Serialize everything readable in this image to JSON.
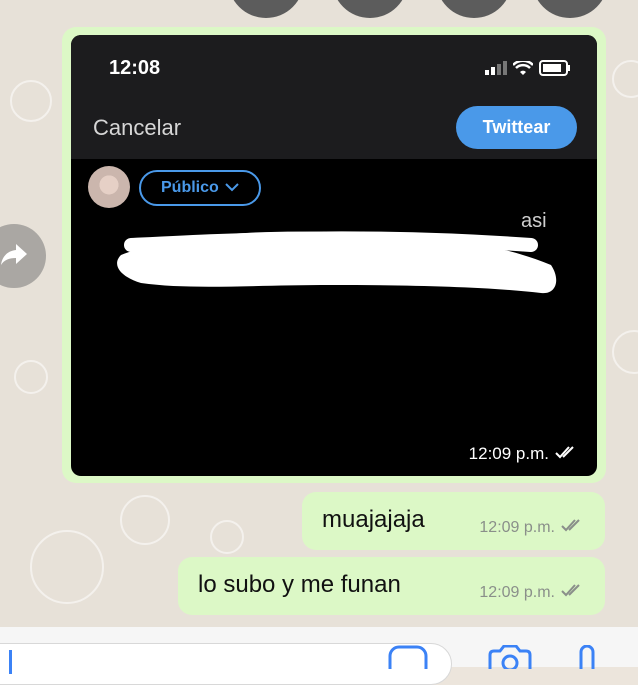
{
  "screenshot": {
    "clock": "12:08",
    "cancel_label": "Cancelar",
    "tweet_button_label": "Twittear",
    "audience_label": "Público",
    "tweet_text_visible": "asi",
    "timestamp": "12:09 p.m."
  },
  "messages": [
    {
      "text": "muajajaja",
      "time": "12:09 p.m."
    },
    {
      "text": "lo subo y me funan",
      "time": "12:09 p.m."
    }
  ],
  "colors": {
    "bubble_outgoing": "#dcf8c6",
    "twitter_blue": "#4a99e9",
    "read_tick": "#8a8f8a"
  },
  "icons": [
    "forward-icon",
    "signal-icon",
    "wifi-icon",
    "battery-icon",
    "chevron-down-icon",
    "double-check-icon",
    "sticker-icon",
    "camera-icon",
    "mic-icon"
  ]
}
